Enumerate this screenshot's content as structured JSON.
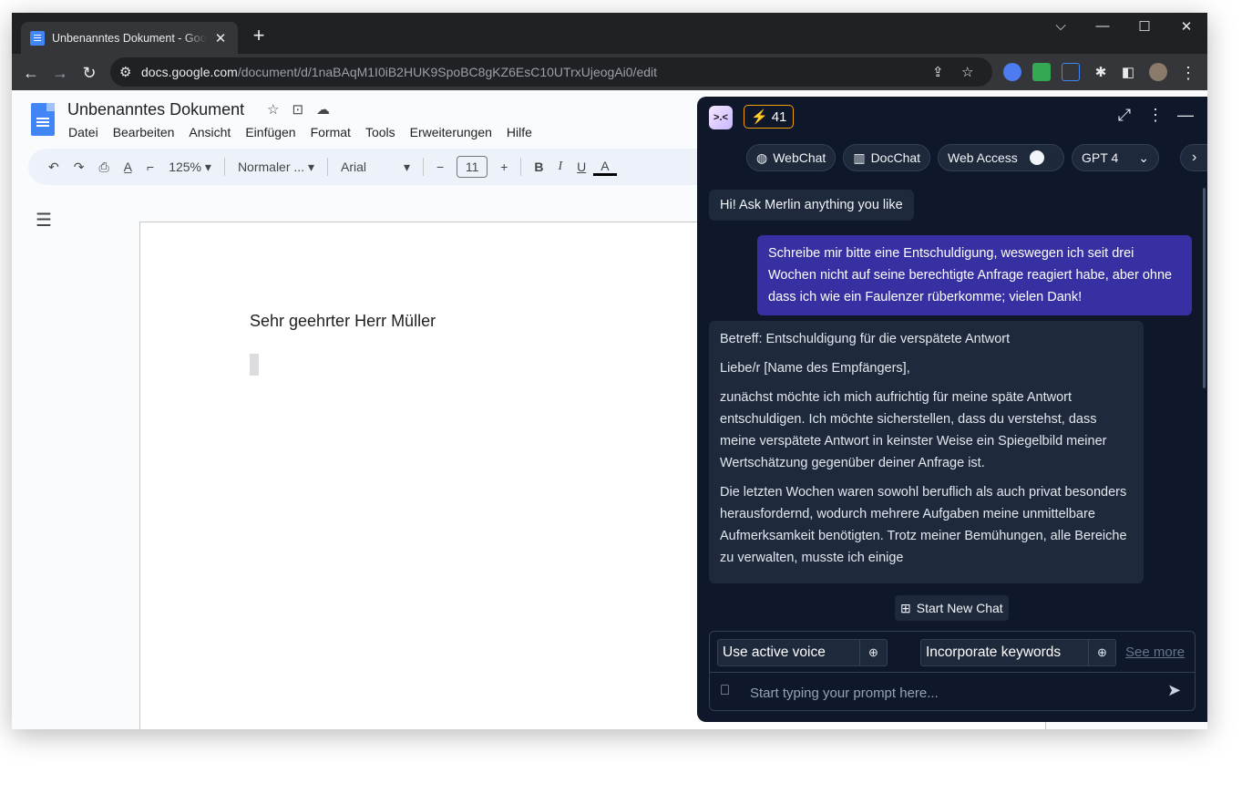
{
  "browser": {
    "tab_title": "Unbenanntes Dokument - Google Docs",
    "url_domain": "docs.google.com",
    "url_path": "/document/d/1naBAqM1I0iB2HUK9SpoBC8gKZ6EsC10UTrxUjeogAi0/edit"
  },
  "docs": {
    "title": "Unbenanntes Dokument",
    "menu": [
      "Datei",
      "Bearbeiten",
      "Ansicht",
      "Einfügen",
      "Format",
      "Tools",
      "Erweiterungen",
      "Hilfe"
    ],
    "zoom": "125%",
    "style": "Normaler ...",
    "font": "Arial",
    "font_size": "11",
    "body_text": "Sehr geehrter Herr Müller"
  },
  "merlin": {
    "logo": ">.<",
    "credits": "41",
    "chips": {
      "webchat": "WebChat",
      "docchat": "DocChat",
      "webaccess": "Web Access",
      "model": "GPT 4"
    },
    "greeting": "Hi! Ask Merlin anything you like",
    "user_message": "Schreibe mir bitte eine Entschuldigung, weswegen ich seit drei Wochen nicht auf seine berechtigte Anfrage reagiert habe, aber ohne dass ich wie ein Faulenzer rüberkomme; vielen Dank!",
    "reply": [
      "Betreff: Entschuldigung für die verspätete Antwort",
      "Liebe/r [Name des Empfängers],",
      "zunächst möchte ich mich aufrichtig für meine späte Antwort entschuldigen. Ich möchte sicherstellen, dass du verstehst, dass meine verspätete Antwort in keinster Weise ein Spiegelbild meiner Wertschätzung gegenüber deiner Anfrage ist.",
      "Die letzten Wochen waren sowohl beruflich als auch privat besonders herausfordernd, wodurch mehrere Aufgaben meine unmittelbare Aufmerksamkeit benötigten. Trotz meiner Bemühungen, alle Bereiche zu verwalten, musste ich einige"
    ],
    "new_chat": "Start New Chat",
    "suggestions": [
      "Use active voice",
      "Incorporate keywords"
    ],
    "see_more": "See more",
    "prompt_placeholder": "Start typing your prompt here..."
  }
}
